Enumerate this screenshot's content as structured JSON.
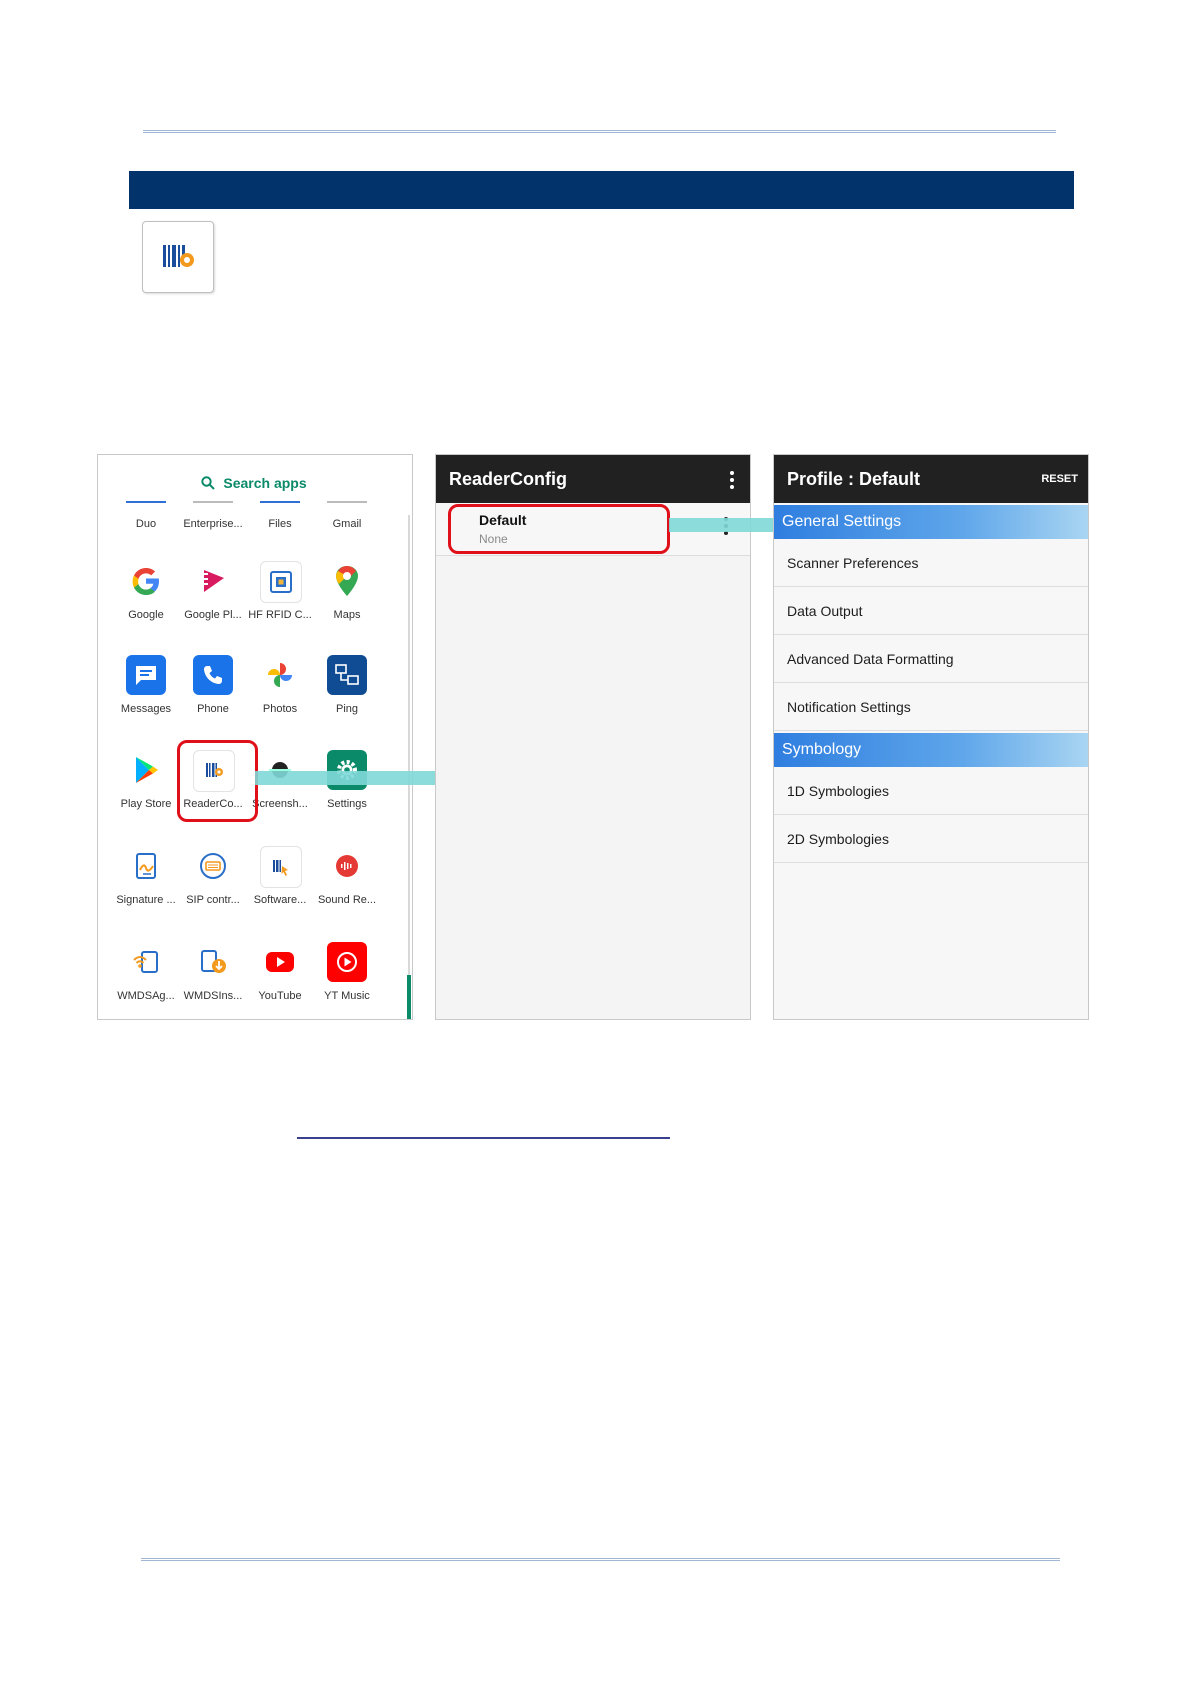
{
  "app_drawer": {
    "search_label": "Search apps",
    "apps": [
      {
        "label": "Duo"
      },
      {
        "label": "Enterprise..."
      },
      {
        "label": "Files"
      },
      {
        "label": "Gmail"
      },
      {
        "label": "Google"
      },
      {
        "label": "Google Pl..."
      },
      {
        "label": "HF RFID C..."
      },
      {
        "label": "Maps"
      },
      {
        "label": "Messages"
      },
      {
        "label": "Phone"
      },
      {
        "label": "Photos"
      },
      {
        "label": "Ping"
      },
      {
        "label": "Play Store"
      },
      {
        "label": "ReaderCo..."
      },
      {
        "label": "Screensh..."
      },
      {
        "label": "Settings"
      },
      {
        "label": "Signature ..."
      },
      {
        "label": "SIP contr..."
      },
      {
        "label": "Software..."
      },
      {
        "label": "Sound Re..."
      },
      {
        "label": "WMDSAg..."
      },
      {
        "label": "WMDSIns..."
      },
      {
        "label": "YouTube"
      },
      {
        "label": "YT Music"
      }
    ]
  },
  "reader_config": {
    "title": "ReaderConfig",
    "profile_name": "Default",
    "profile_sub": "None"
  },
  "profile": {
    "title": "Profile : Default",
    "reset_label": "RESET",
    "general_header": "General Settings",
    "general_items": [
      "Scanner Preferences",
      "Data Output",
      "Advanced Data Formatting",
      "Notification Settings"
    ],
    "symbology_header": "Symbology",
    "symbology_items": [
      "1D Symbologies",
      "2D Symbologies"
    ]
  },
  "colors": {
    "banner": "#02346b",
    "highlight": "#e0101a",
    "arrow": "#7fd8d8",
    "accent": "#0b8a6a"
  }
}
